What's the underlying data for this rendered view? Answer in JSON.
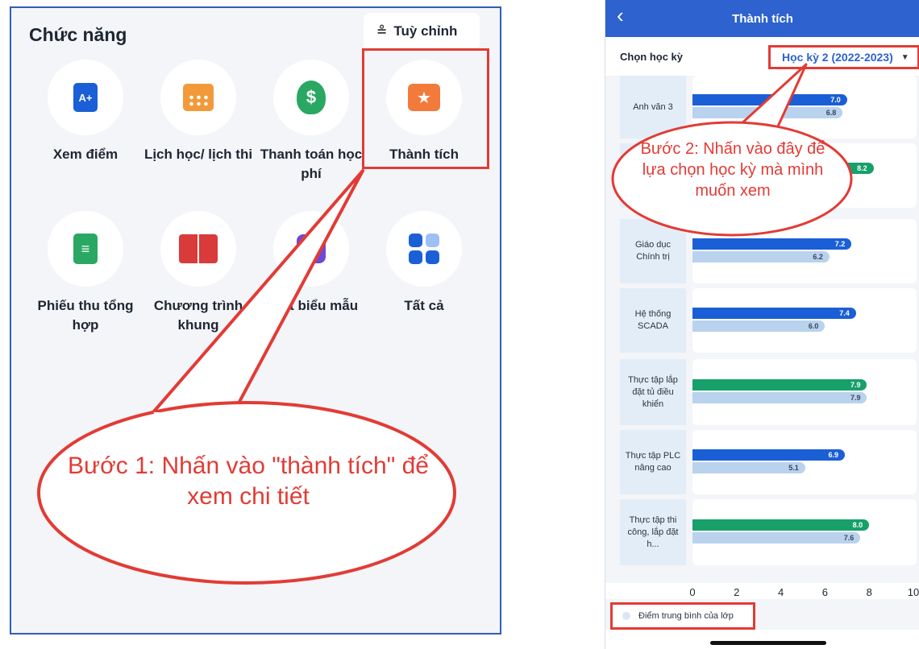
{
  "left": {
    "title": "Chức năng",
    "customize_label": "Tuỳ chỉnh",
    "items": [
      {
        "label": "Xem điểm",
        "icon": "grade-document-icon",
        "glyph": "A+"
      },
      {
        "label": "Lịch học/ lịch thi",
        "icon": "calendar-icon",
        "glyph": ""
      },
      {
        "label": "Thanh toán học phí",
        "icon": "money-bag-icon",
        "glyph": "$"
      },
      {
        "label": "Thành tích",
        "icon": "achievement-star-icon",
        "glyph": "★"
      },
      {
        "label": "Phiếu thu tổng hợp",
        "icon": "receipt-list-icon",
        "glyph": "≡"
      },
      {
        "label": "Chương trình khung",
        "icon": "book-icon",
        "glyph": ""
      },
      {
        "label": "Xuất biểu mẫu",
        "icon": "export-form-icon",
        "glyph": ""
      },
      {
        "label": "Tất cả",
        "icon": "all-apps-grid-icon",
        "glyph": ""
      }
    ],
    "callout": "Bước 1: Nhấn vào \"thành tích\" để xem chi tiết"
  },
  "phone": {
    "title": "Thành tích",
    "semester_label": "Chọn học kỳ",
    "semester_value": "Học kỳ 2 (2022-2023)",
    "callout": "Bước 2: Nhấn vào đây để lựa chọn học kỳ mà mình muốn xem",
    "legend_label": "Điểm trung bình của lớp",
    "colors": {
      "header": "#2d62cf",
      "my_score": "#1b5fd6",
      "high_score": "#17a06a",
      "class_avg": "#b9d2ee",
      "annotation": "#e23b35"
    }
  },
  "chart_data": {
    "type": "bar",
    "orientation": "horizontal",
    "categories": [
      "Anh văn 3",
      "",
      "Giáo dục Chính trị",
      "Hệ thống SCADA",
      "Thực tập lắp đặt tủ điều khiển",
      "Thực tập PLC nâng cao",
      "Thực tập thi công, lắp đặt h..."
    ],
    "series": [
      {
        "values": [
          7.0,
          8.2,
          7.2,
          7.4,
          7.9,
          6.9,
          8.0
        ]
      },
      {
        "name": "Điểm trung bình của lớp",
        "values": [
          6.8,
          null,
          6.2,
          6.0,
          7.9,
          5.1,
          7.6
        ]
      }
    ],
    "x_ticks": [
      "0",
      "2",
      "4",
      "6",
      "8",
      "10"
    ],
    "xlim": [
      0,
      10
    ],
    "legend": "bottom-left"
  }
}
